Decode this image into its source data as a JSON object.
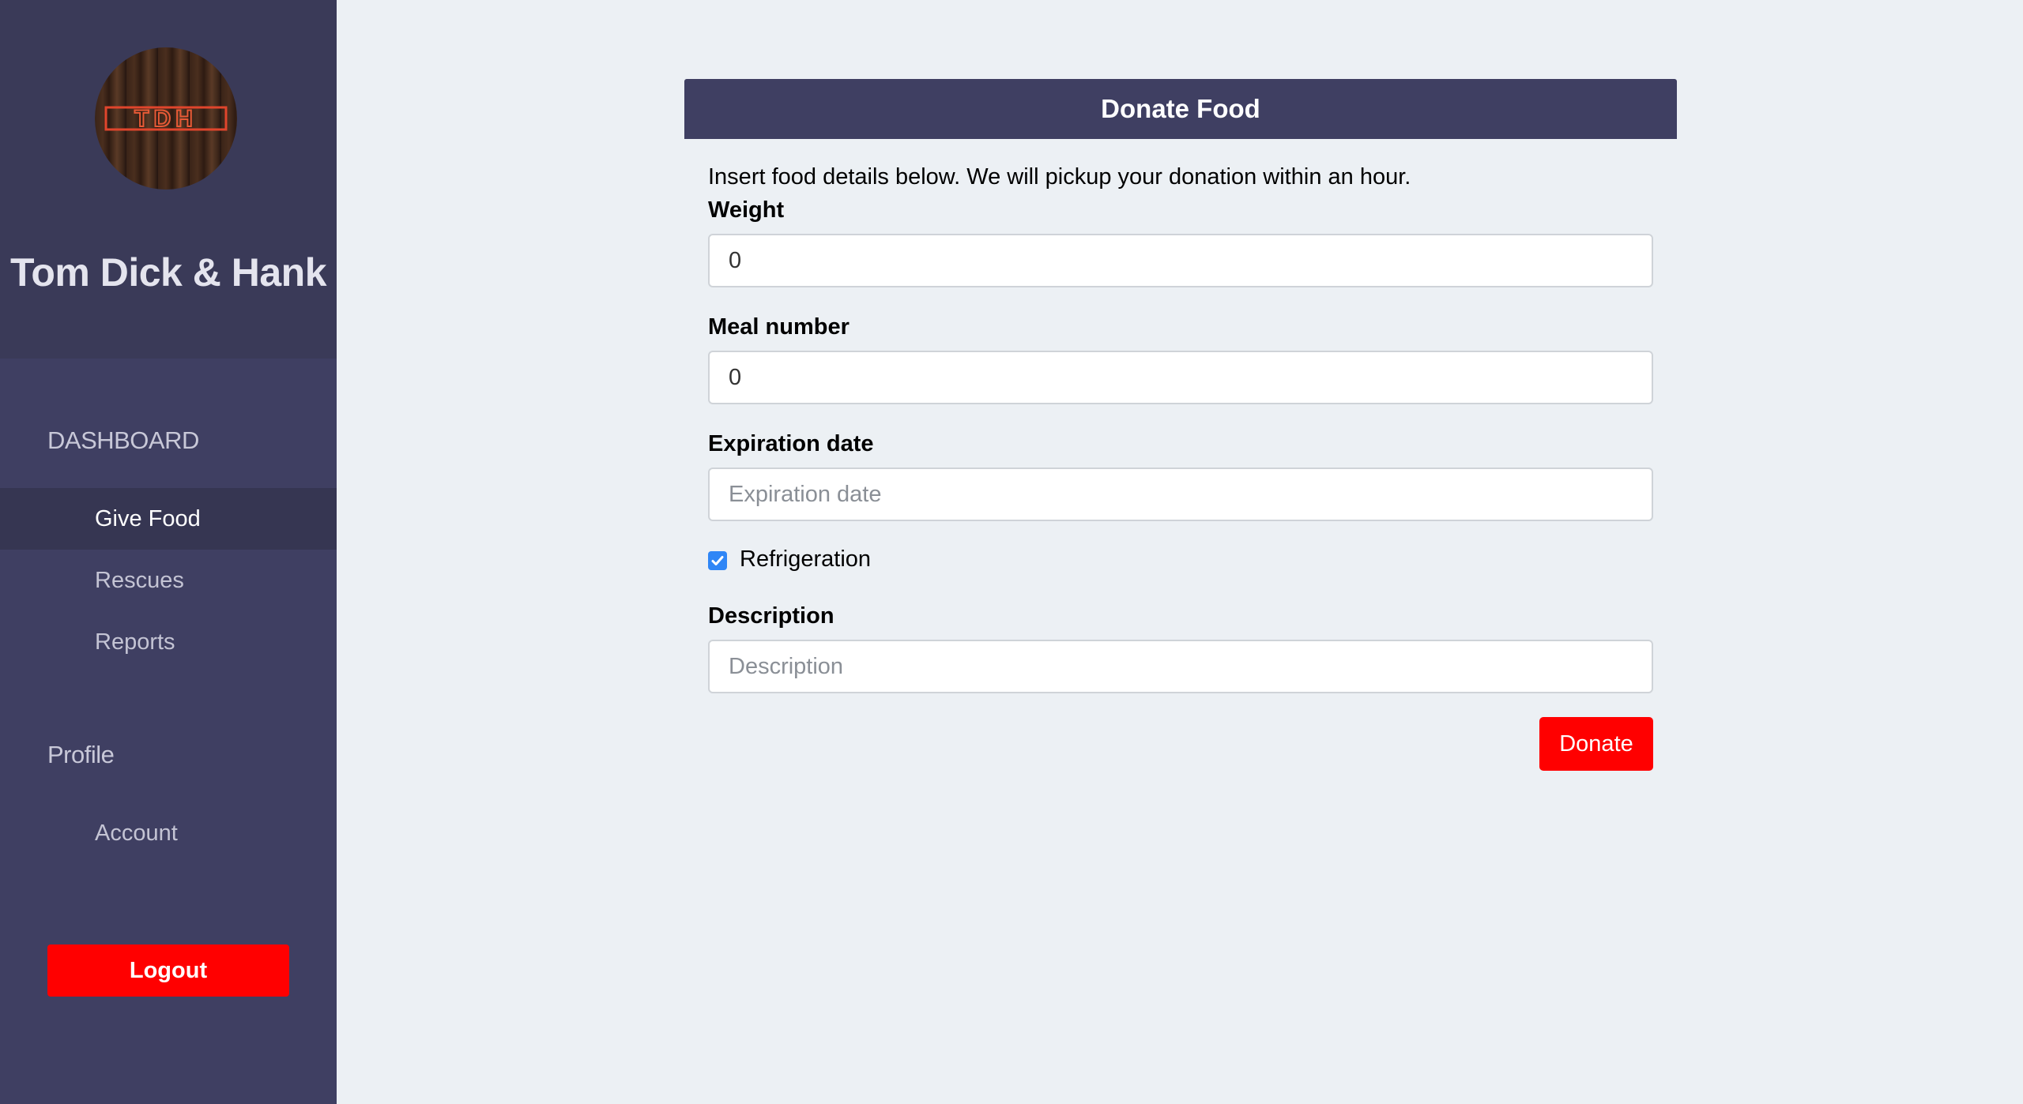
{
  "sidebar": {
    "logo_text": "TDH",
    "brand": "Tom Dick & Hank",
    "dashboard_title": "DASHBOARD",
    "items": [
      {
        "label": "Give Food",
        "active": true
      },
      {
        "label": "Rescues",
        "active": false
      },
      {
        "label": "Reports",
        "active": false
      }
    ],
    "profile_title": "Profile",
    "profile_items": [
      {
        "label": "Account"
      }
    ],
    "logout_label": "Logout"
  },
  "form": {
    "header": "Donate Food",
    "intro": "Insert food details below. We will pickup your donation within an hour.",
    "weight_label": "Weight",
    "weight_value": "0",
    "meal_label": "Meal number",
    "meal_value": "0",
    "expiration_label": "Expiration date",
    "expiration_placeholder": "Expiration date",
    "refrigeration_label": "Refrigeration",
    "refrigeration_checked": true,
    "description_label": "Description",
    "description_placeholder": "Description",
    "donate_label": "Donate"
  },
  "colors": {
    "sidebar_bg": "#3f3f62",
    "accent_red": "#ff0000",
    "checkbox_blue": "#2f86f6",
    "page_bg": "#ecf0f4"
  }
}
